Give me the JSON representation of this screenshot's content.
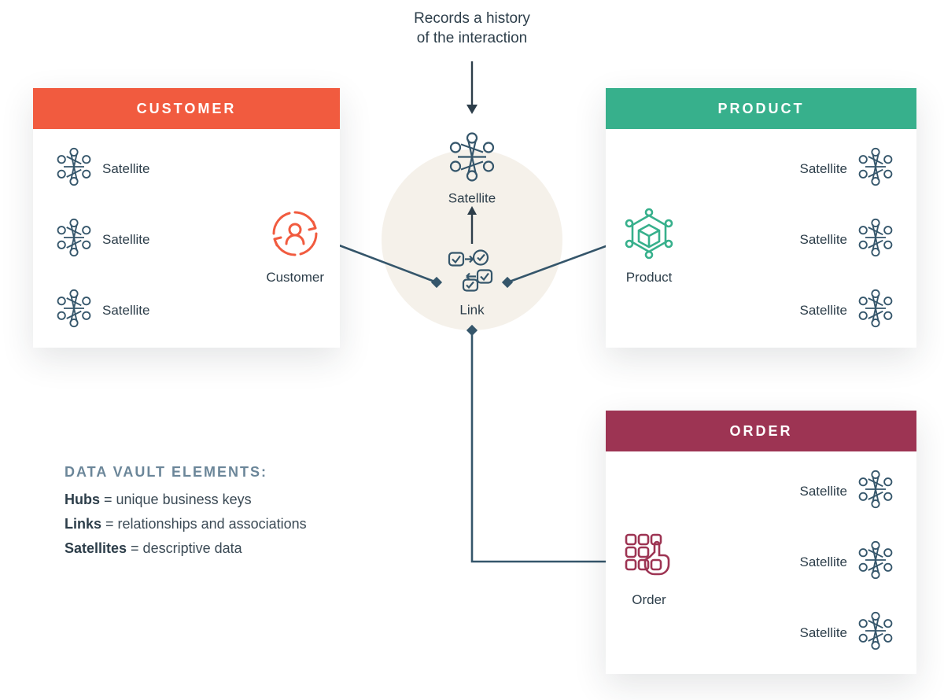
{
  "caption_line1": "Records a history",
  "caption_line2": "of the interaction",
  "center": {
    "satellite_label": "Satellite",
    "link_label": "Link"
  },
  "customer": {
    "header": "CUSTOMER",
    "hub_label": "Customer",
    "satellites": [
      "Satellite",
      "Satellite",
      "Satellite"
    ]
  },
  "product": {
    "header": "PRODUCT",
    "hub_label": "Product",
    "satellites": [
      "Satellite",
      "Satellite",
      "Satellite"
    ]
  },
  "order": {
    "header": "ORDER",
    "hub_label": "Order",
    "satellites": [
      "Satellite",
      "Satellite",
      "Satellite"
    ]
  },
  "legend": {
    "title": "DATA VAULT ELEMENTS:",
    "hubs_term": "Hubs",
    "hubs_def": " = unique business keys",
    "links_term": "Links",
    "links_def": " = relationships and associations",
    "sats_term": "Satellites",
    "sats_def": " = descriptive data"
  },
  "colors": {
    "ink": "#35566b",
    "customer": "#f15b3f",
    "product": "#37b08c",
    "order": "#9d3453"
  }
}
